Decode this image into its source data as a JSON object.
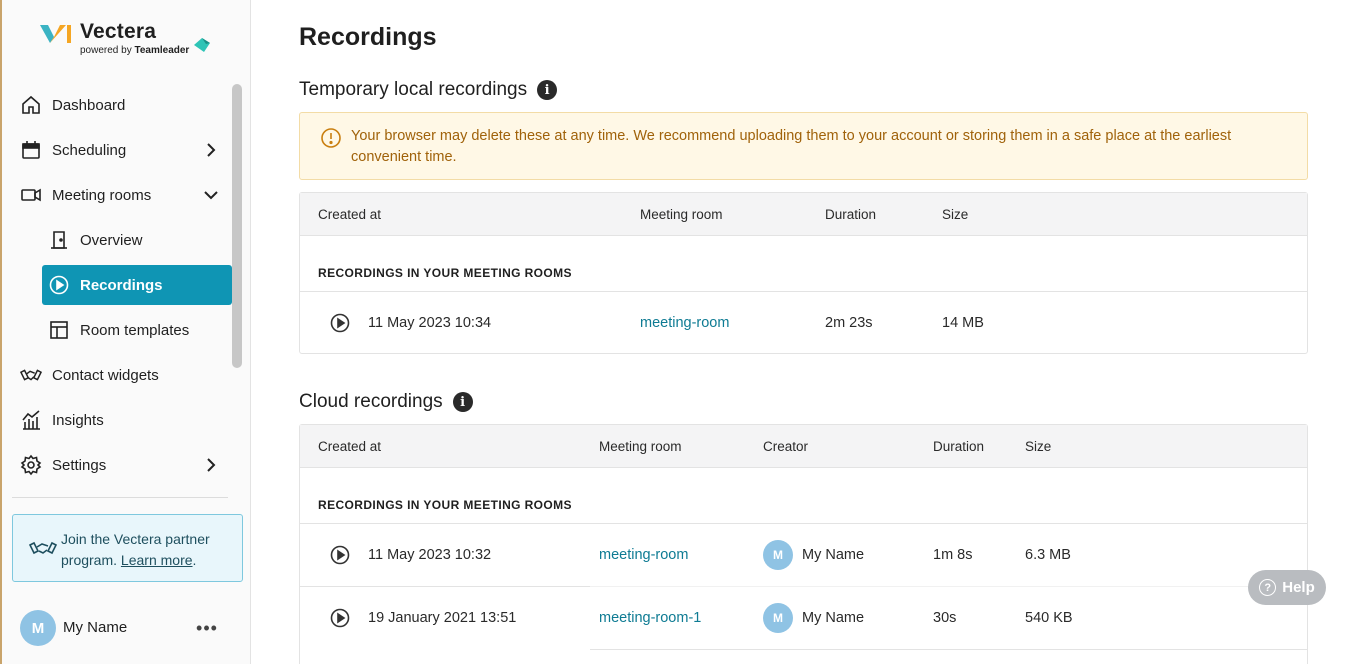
{
  "brand": {
    "name": "Vectera",
    "sub_prefix": "powered by",
    "sub_brand": "Teamleader"
  },
  "sidebar": {
    "items": [
      {
        "label": "Dashboard",
        "icon": "home-icon"
      },
      {
        "label": "Scheduling",
        "icon": "calendar-icon"
      },
      {
        "label": "Meeting rooms",
        "icon": "video-camera-icon"
      },
      {
        "label": "Overview",
        "icon": "door-icon"
      },
      {
        "label": "Recordings",
        "icon": "play-circle-icon"
      },
      {
        "label": "Room templates",
        "icon": "layout-template-icon"
      },
      {
        "label": "Contact widgets",
        "icon": "handshake-icon"
      },
      {
        "label": "Insights",
        "icon": "chart-icon"
      },
      {
        "label": "Settings",
        "icon": "gear-icon"
      }
    ],
    "active": "Recordings",
    "partner": {
      "text": "Join the Vectera partner program.",
      "link": "Learn more"
    },
    "user": {
      "initial": "M",
      "name": "My Name",
      "more": "•••"
    }
  },
  "main": {
    "title": "Recordings",
    "local": {
      "title": "Temporary local recordings",
      "warning": "Your browser may delete these at any time. We recommend uploading them to your account or storing them in a safe place at the earliest convenient time.",
      "columns": [
        "Created at",
        "Meeting room",
        "Duration",
        "Size"
      ],
      "group": "RECORDINGS IN YOUR MEETING ROOMS",
      "rows": [
        {
          "created": "11 May 2023 10:34",
          "room": "meeting-room",
          "duration": "2m 23s",
          "size": "14 MB"
        }
      ]
    },
    "cloud": {
      "title": "Cloud recordings",
      "columns": [
        "Created at",
        "Meeting room",
        "Creator",
        "Duration",
        "Size"
      ],
      "group": "RECORDINGS IN YOUR MEETING ROOMS",
      "rows": [
        {
          "created": "11 May 2023 10:32",
          "room": "meeting-room",
          "creator_initial": "M",
          "creator": "My Name",
          "duration": "1m 8s",
          "size": "6.3 MB"
        },
        {
          "created": "19 January 2021 13:51",
          "room": "meeting-room-1",
          "creator_initial": "M",
          "creator": "My Name",
          "duration": "30s",
          "size": "540 KB"
        }
      ]
    }
  },
  "help": {
    "label": "Help"
  },
  "colors": {
    "accent": "#0f95b4",
    "link": "#0e7b93",
    "warning_bg": "#fff8e6",
    "warning_text": "#a0620a"
  }
}
